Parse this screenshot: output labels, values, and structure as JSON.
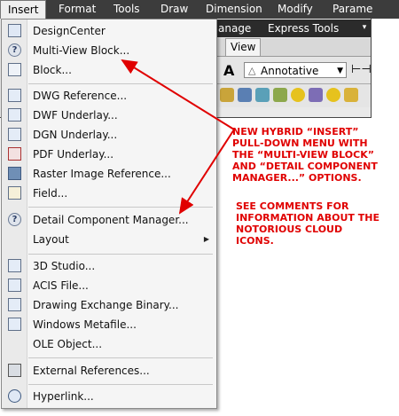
{
  "menubar": {
    "items": [
      "Insert",
      "Format",
      "Tools",
      "Draw",
      "Dimension",
      "Modify",
      "Parame"
    ]
  },
  "ribbon": {
    "tab_row_items": [
      "anage",
      "Express Tools"
    ],
    "view_tab": "View",
    "annotation_style": "Annotative"
  },
  "menu": {
    "items": [
      {
        "label": "DesignCenter",
        "icon": "designcenter-icon"
      },
      {
        "label": "Multi-View Block...",
        "icon": "help-icon"
      },
      {
        "label": "Block...",
        "icon": "block-icon"
      },
      {
        "label": "DWG Reference...",
        "icon": "dwg-icon"
      },
      {
        "label": "DWF Underlay...",
        "icon": "dwf-icon"
      },
      {
        "label": "DGN Underlay...",
        "icon": "dgn-icon"
      },
      {
        "label": "PDF Underlay...",
        "icon": "pdf-icon"
      },
      {
        "label": "Raster Image Reference...",
        "icon": "raster-image-icon"
      },
      {
        "label": "Field...",
        "icon": "field-icon"
      },
      {
        "label": "Detail Component Manager...",
        "icon": "help-icon"
      },
      {
        "label": "Layout",
        "icon": "",
        "submenu": true
      },
      {
        "label": "3D Studio...",
        "icon": "3ds-icon"
      },
      {
        "label": "ACIS File...",
        "icon": "acis-icon"
      },
      {
        "label": "Drawing Exchange Binary...",
        "icon": "dxb-icon"
      },
      {
        "label": "Windows Metafile...",
        "icon": "wmf-icon"
      },
      {
        "label": "OLE Object...",
        "icon": "ole-icon"
      },
      {
        "label": "External References...",
        "icon": "xref-icon"
      },
      {
        "label": "Hyperlink...",
        "icon": "hyperlink-icon"
      }
    ]
  },
  "annotations": {
    "note1": [
      "NEW HYBRID “INSERT”",
      "PULL-DOWN MENU WITH",
      "THE “MULTI-VIEW BLOCK”",
      "AND “DETAIL COMPONENT",
      "MANAGER...” OPTIONS."
    ],
    "note2": [
      "SEE COMMENTS FOR",
      "INFORMATION ABOUT THE",
      "NOTORIOUS CLOUD",
      "ICONS."
    ],
    "color": "#e00000"
  }
}
